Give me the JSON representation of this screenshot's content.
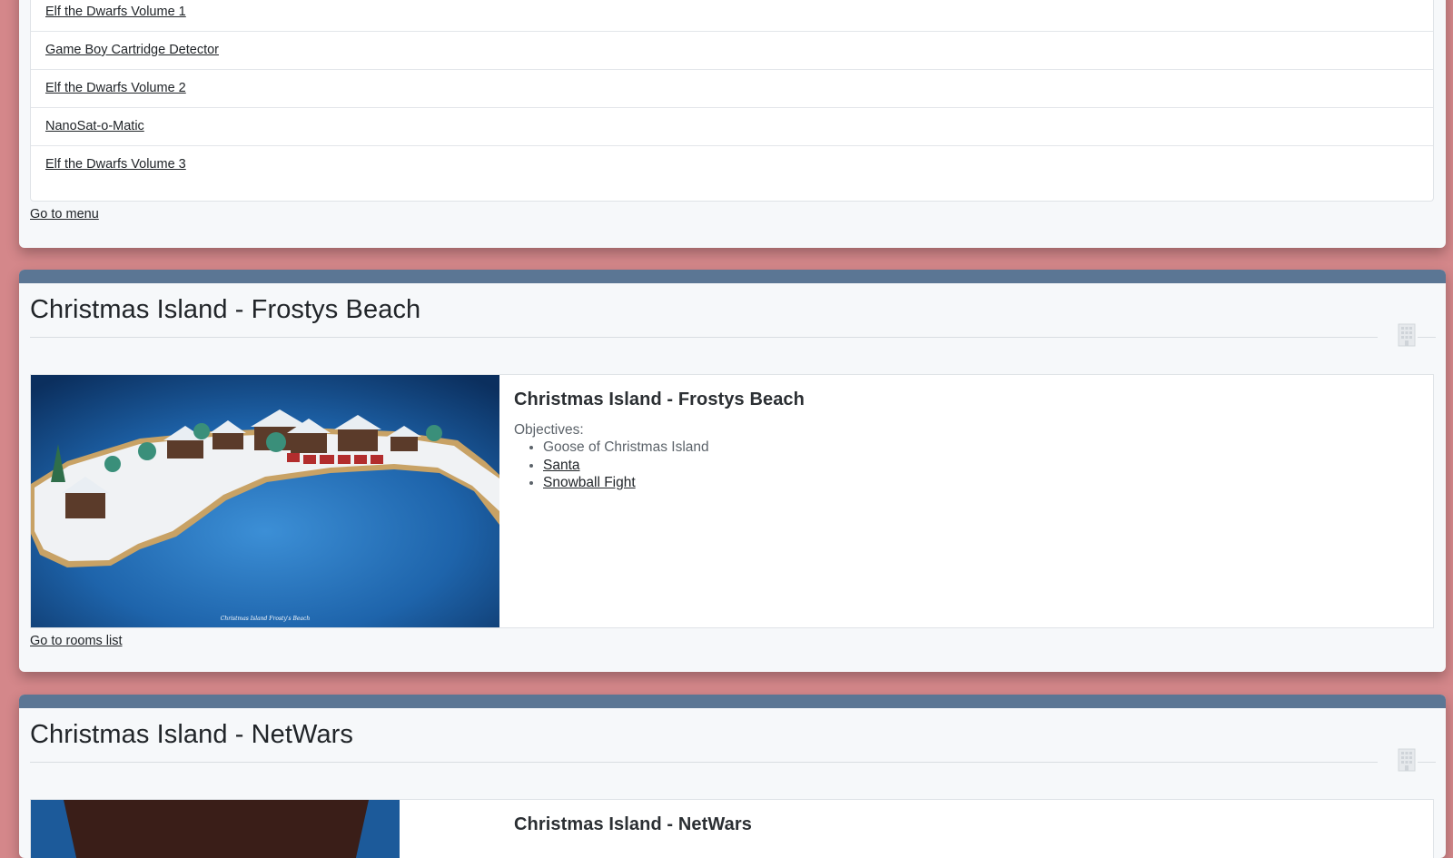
{
  "top_list": {
    "items": [
      "Elf the Dwarfs Volume 1",
      "Game Boy Cartridge Detector",
      "Elf the Dwarfs Volume 2",
      "NanoSat-o-Matic",
      "Elf the Dwarfs Volume 3"
    ],
    "go_to_menu": "Go to menu"
  },
  "rooms": [
    {
      "heading": "Christmas Island - Frostys Beach",
      "title": "Christmas Island - Frostys Beach",
      "objectives_label": "Objectives:",
      "objectives": [
        {
          "text": "Goose of Christmas Island",
          "link": false
        },
        {
          "text": "Santa",
          "link": true
        },
        {
          "text": "Snowball Fight",
          "link": true
        }
      ],
      "image_caption": "Christmas Island Frosty's Beach",
      "go_to_rooms": "Go to rooms list"
    },
    {
      "heading": "Christmas Island - NetWars",
      "title": "Christmas Island - NetWars"
    }
  ],
  "icons": {
    "room_icon": "building-icon"
  },
  "colors": {
    "background": "#d4878a",
    "card_band": "#5b7694",
    "card_bg": "#f6f8fa"
  }
}
